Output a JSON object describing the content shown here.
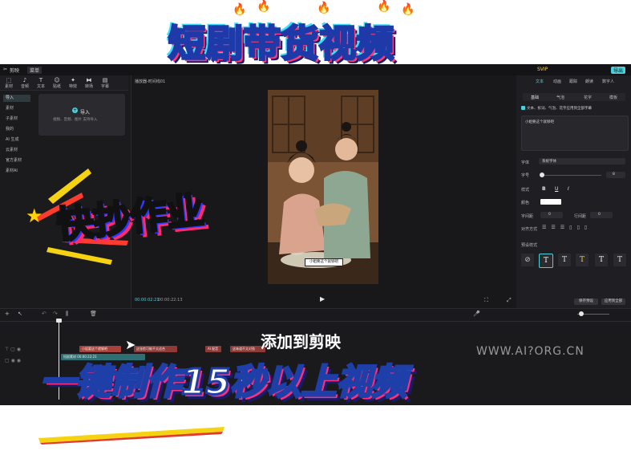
{
  "app": {
    "name": "剪映",
    "menu": "菜单"
  },
  "overlay": {
    "headline": "短剧带货视频",
    "sticker": "快抄作业",
    "bottomline": "一键制作15秒以上视频",
    "bgtext": "添加到剪映",
    "watermark": "WWW.AI?ORG.CN"
  },
  "toolbar": {
    "items": [
      {
        "icon": "import-icon",
        "glyph": "⬚",
        "label": "素材"
      },
      {
        "icon": "music-icon",
        "glyph": "♪",
        "label": "音频"
      },
      {
        "icon": "text-icon",
        "glyph": "T",
        "label": "文本"
      },
      {
        "icon": "sticker-icon",
        "glyph": "☺",
        "label": "贴纸"
      },
      {
        "icon": "effects-icon",
        "glyph": "✦",
        "label": "特效"
      },
      {
        "icon": "transition-icon",
        "glyph": "⧓",
        "label": "转场"
      },
      {
        "icon": "subtitle-icon",
        "glyph": "▤",
        "label": "字幕"
      }
    ]
  },
  "nav": [
    "导入",
    "素材",
    "子素材",
    "我的",
    "AI 生成",
    "云素材",
    "官方素材",
    "素材AI"
  ],
  "import": {
    "label": "导入",
    "sub": "视频、音频、图片 支持导入"
  },
  "player": {
    "title": "播放器-时间线01",
    "time_current": "00:00:02:21",
    "time_total": "00:00:22:13",
    "play_glyph": "▶"
  },
  "video_caption": "小姐要这个就够吧",
  "right": {
    "top": {
      "upgrade": "SVIP",
      "export": "导出"
    },
    "tabs": [
      "文本",
      "动画",
      "跟踪",
      "朗读",
      "数字人"
    ],
    "subtabs": [
      "基础",
      "气泡",
      "花字",
      "模板"
    ],
    "checkbox": "文本、拆词、气泡、花字应用到全部字幕",
    "textbox": "小姐要这个就够吧",
    "props": {
      "font": "字体",
      "font_value": "系统字体",
      "size": "字号",
      "size_value": "8",
      "style": "样式",
      "color": "颜色",
      "spacing": "字间距",
      "spacing_value": "0",
      "line": "行间距",
      "line_value": "0",
      "align": "对齐方式"
    },
    "preset": "预设样式",
    "buttons": {
      "save": "保存预设",
      "apply": "应用到全部"
    }
  },
  "timeline": {
    "clips": [
      {
        "label": "小姐要这个就够吧"
      },
      {
        "label": "这张脸可能不太适合"
      },
      {
        "label": "AI 配音"
      },
      {
        "label": "这味道不太对劲"
      }
    ],
    "video_clip": "短剧素材 00:00:22:21"
  },
  "colors": {
    "accent": "#4ed0dc",
    "panel": "#1b1b1e",
    "headline_stroke": "#1d3aa8"
  }
}
